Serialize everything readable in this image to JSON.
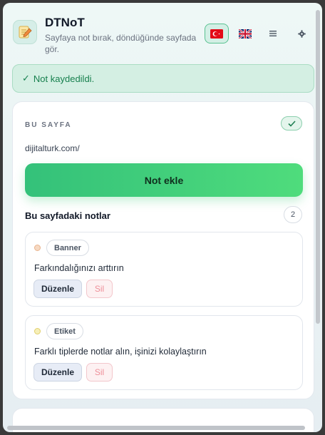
{
  "header": {
    "app_title": "DTNoT",
    "app_subtitle": "Sayfaya not bırak, döndüğünde sayfada gör.",
    "logo_icon": "notepad-pencil-icon",
    "languages": [
      {
        "code": "tr",
        "icon": "turkey-flag-icon",
        "active": true
      },
      {
        "code": "en",
        "icon": "uk-flag-icon",
        "active": false
      }
    ],
    "menu_icon": "hamburger-menu-icon",
    "settings_icon": "gear-icon"
  },
  "toast": {
    "text": "Not kaydedildi.",
    "icon": "check-icon"
  },
  "page_section": {
    "label": "BU SAYFA",
    "url": "dijitalturk.com/",
    "add_button": "Not ekle",
    "notes_title": "Bu sayfadaki notlar",
    "notes_count": "2"
  },
  "notes": [
    {
      "tag": "Banner",
      "text": "Farkındalığınızı arttırın",
      "dot_color": "#f6d9c2",
      "dot_border": "#e9b48f",
      "edit": "Düzenle",
      "delete": "Sil"
    },
    {
      "tag": "Etiket",
      "text": "Farklı tiplerde notlar alın, işinizi kolaylaştırın",
      "dot_color": "#f6efb8",
      "dot_border": "#e1cf6b",
      "edit": "Düzenle",
      "delete": "Sil"
    }
  ],
  "colors": {
    "accent": "#3ccf7a",
    "success_text": "#17804e",
    "danger_text": "#ee8f99"
  }
}
